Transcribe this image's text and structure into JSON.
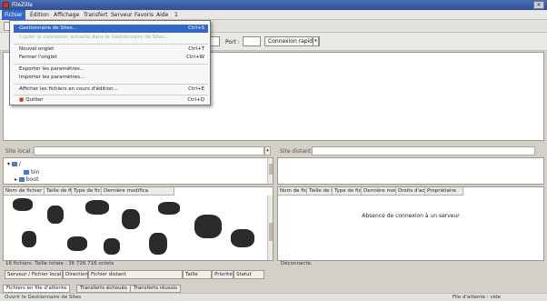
{
  "window": {
    "title": "FileZilla"
  },
  "menubar": [
    "Fichier",
    "Édition",
    "Affichage",
    "Transfert",
    "Serveur",
    "Favoris",
    "Aide",
    "1"
  ],
  "dropdown": {
    "items": [
      {
        "label": "Gestionnaire de Sites...",
        "shortcut": "Ctrl+S",
        "selected": true,
        "disabled": false
      },
      {
        "label": "Copier la connexion actuelle dans le Gestionnaire de Sites...",
        "shortcut": "",
        "selected": false,
        "disabled": true
      },
      {
        "label": "Nouvel onglet",
        "shortcut": "Ctrl+T",
        "selected": false,
        "disabled": false
      },
      {
        "label": "Fermer l'onglet",
        "shortcut": "Ctrl+W",
        "selected": false,
        "disabled": false
      },
      {
        "label": "Exporter les paramètres...",
        "shortcut": "",
        "selected": false,
        "disabled": false
      },
      {
        "label": "Importer les paramètres...",
        "shortcut": "",
        "selected": false,
        "disabled": false
      },
      {
        "label": "Afficher les fichiers en cours d'édition...",
        "shortcut": "Ctrl+E",
        "selected": false,
        "disabled": false
      },
      {
        "label": "Quitter",
        "shortcut": "Ctrl+Q",
        "selected": false,
        "disabled": false
      }
    ]
  },
  "quickconnect": {
    "port_label": "Port :",
    "button_label": "Connexion rapide",
    "dropdown_glyph": "▾"
  },
  "local": {
    "site_label": "Site local :",
    "tree": [
      "/",
      "bin",
      "boot"
    ],
    "columns": [
      "Nom de fichier",
      "Taille de fichier",
      "Type de fichier",
      "Dernière modifica"
    ],
    "status": "16 fichiers. Taille totale : 36 726 716 octets"
  },
  "remote": {
    "site_label": "Site distant :",
    "columns": [
      "Nom de fichier",
      "Taille de fichier",
      "Type de fichier",
      "Dernière modifica",
      "Droits d'accès",
      "Propriétaire"
    ],
    "message": "Absence de connexion à un serveur",
    "status": "Déconnecté."
  },
  "queue": {
    "columns": [
      "Serveur / Fichier local",
      "Direction",
      "Fichier distant",
      "Taille",
      "Priorité",
      "Statut"
    ]
  },
  "bottom_tabs": [
    "Fichiers en file d'attente",
    "Transferts échoués",
    "Transferts réussis"
  ],
  "statusbar": {
    "left": "Ouvrir le Gestionnaire de Sites",
    "right": "File d'attente : vide"
  }
}
